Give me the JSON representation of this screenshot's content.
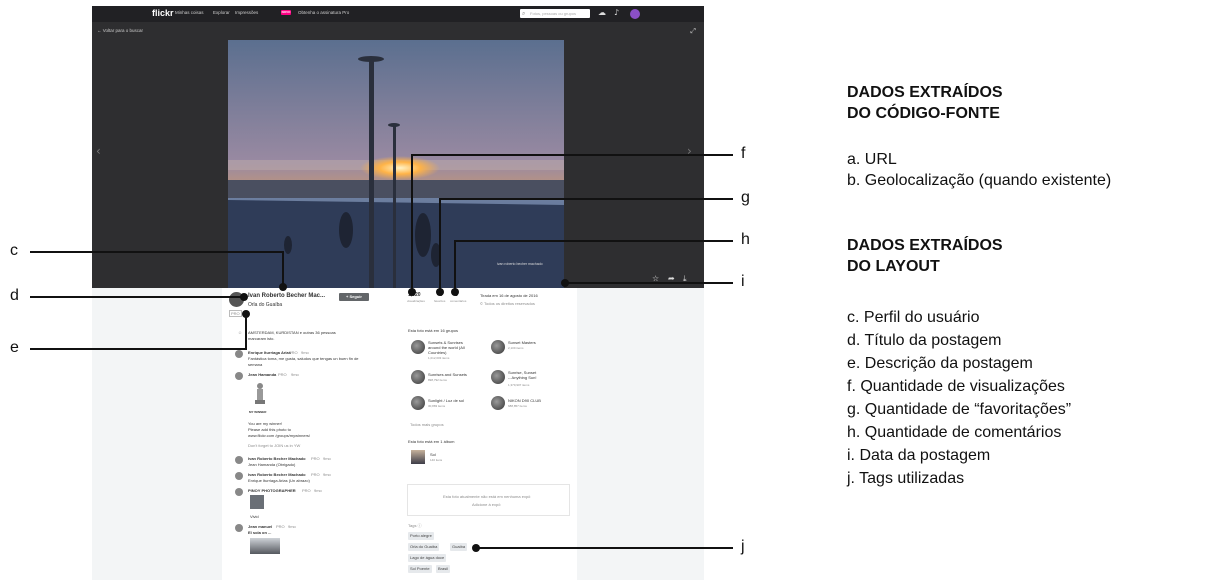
{
  "flickr": {
    "logo": "flickr",
    "nav": [
      "Minhas coisas",
      "Explorar",
      "Impressões",
      "Obtenha o assinatura Pro"
    ],
    "badge": "NOVO",
    "search_placeholder": "Fotos, pessoas ou grupos",
    "back_label": "Voltar para o buscar",
    "caption": "ivan roberto becher machado",
    "owner_name": "Ivan Roberto Becher Mac...",
    "follow_label": "+ Seguir",
    "title": "Orla do Guaíba",
    "pro_badge": "PRO",
    "description_line1": "AMSTERDAM, KURDISTAN e outras 36 pessoas",
    "description_line2": "marcaram isto.",
    "stats": {
      "views": "1,620",
      "views_label": "visualizações",
      "faves": "40",
      "faves_label": "favoritos",
      "comments": "8",
      "comments_label": "comentários"
    },
    "date_taken": "Tirada em 16 de agosto de 2016",
    "rights": "Todos os direitos reservados",
    "groups_header": "Esta foto está em 16 grupos",
    "groups": [
      {
        "name": "Sunsets & Sunrises around the world (All Countries)",
        "count": "1,012,003 items"
      },
      {
        "name": "Sunset Masters",
        "count": "2,109 items"
      },
      {
        "name": "Sunrises and Sunsets",
        "count": "898,792 items"
      },
      {
        "name": "Sunrise, Sunset -- Anything Sun!",
        "count": "1,379,907 items"
      },
      {
        "name": "Sunlight / Luz de sol",
        "count": "30,883 items"
      },
      {
        "name": "NIKON D90 CLUB",
        "count": "688,857 items"
      }
    ],
    "all_groups": "Todos mais grupos",
    "album_header": "Esta foto está em 1 álbum",
    "album_name": "Sol",
    "album_count": "140 itens",
    "gallery_text": "Esta foto atualmente não está em nenhuma expô",
    "gallery_link": "Adicione à expô",
    "tags_header": "Tags",
    "tags": [
      "Porto alegre",
      "Orla do Guaíba",
      "Guaíba",
      "Lago de água doce",
      "Sol Poente",
      "Brasil"
    ],
    "comments": [
      {
        "author": "Enrique Iturriaga Arias",
        "badge": "PRO",
        "time": "9mo",
        "text1": "Fantástica toma, me gusta, saludos que tengas un buen fin de",
        "text2": "semana"
      },
      {
        "author": "Jean Hamanda",
        "badge": "PRO",
        "time": "9mo",
        "text1": "",
        "text2": ""
      },
      {
        "author": "Ivan Roberto Becher Machado",
        "badge": "PRO",
        "time": "9mo",
        "text1": "Jean Hamanda (Obrigado)",
        "text2": ""
      },
      {
        "author": "Ivan Roberto Becher Machado",
        "badge": "PRO",
        "time": "9mo",
        "text1": "Enrique Iturriaga Arias (Un abrazo)",
        "text2": ""
      },
      {
        "author": "PINOY PHOTOGRAPHER",
        "badge": "PRO",
        "time": "9mo",
        "text1": "",
        "text2": ""
      },
      {
        "author": "Jean manuel",
        "badge": "PRO",
        "time": "9mo",
        "text1": "El sola on ...",
        "text2": ""
      }
    ],
    "my_winner_title": "MY WINNER",
    "winner_lines": [
      "You are my winner!",
      "Please add this photo to",
      "www.flickr.com /groups/mywinners/",
      "Don't forget to JOIN us in YW"
    ],
    "vivid_label": "Vivid"
  },
  "callouts": [
    "c",
    "d",
    "e",
    "f",
    "g",
    "h",
    "i",
    "j"
  ],
  "legend": {
    "source_heading_1": "DADOS EXTRAÍDOS",
    "source_heading_2": "DO CÓDIGO-FONTE",
    "source_items": [
      "a. URL",
      "b. Geolocalização (quando existente)"
    ],
    "layout_heading_1": "DADOS EXTRAÍDOS",
    "layout_heading_2": "DO LAYOUT",
    "layout_items": [
      "c. Perfil do usuário",
      "d. Título da postagem",
      "e. Descrição da postagem",
      "f. Quantidade de visualizações",
      "g. Quantidade de “favoritações”",
      "h. Quantidade de comentários",
      "i. Data da postagem",
      "j. Tags utilizadas"
    ]
  }
}
